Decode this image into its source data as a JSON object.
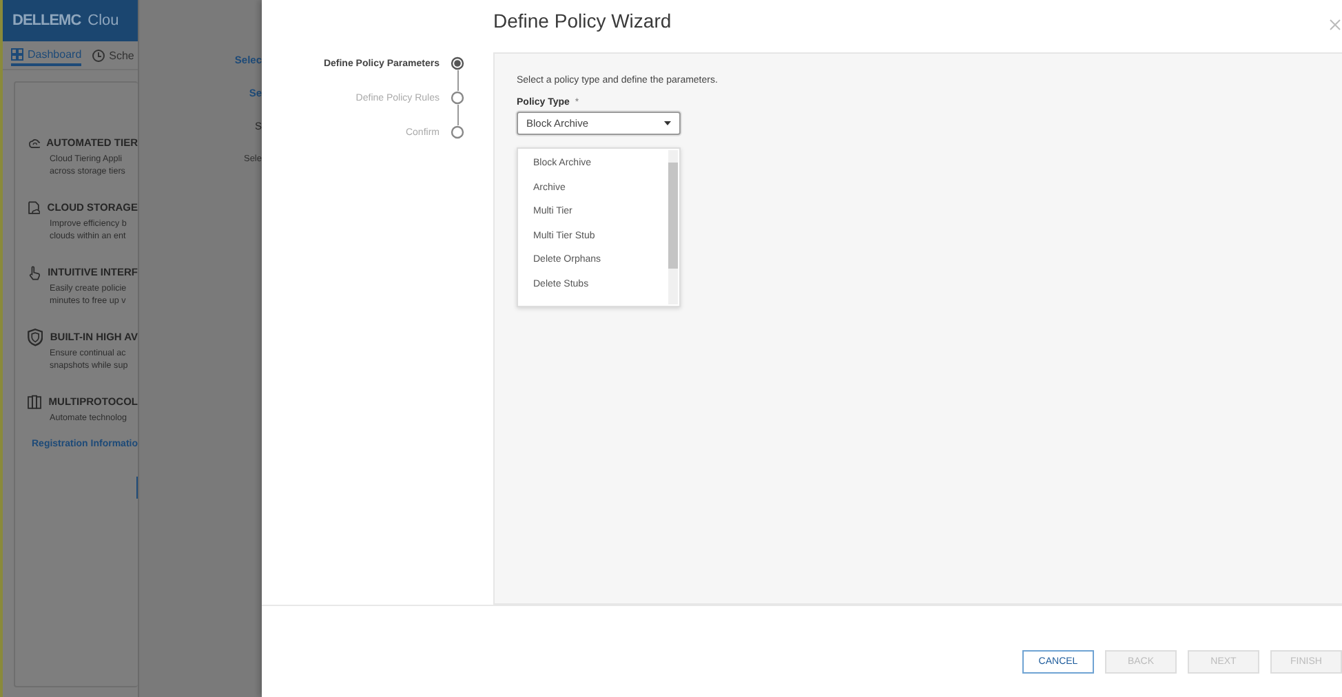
{
  "app": {
    "brand": "DELLEMC",
    "product": "Clou",
    "tabs": [
      {
        "label": "Dashboard",
        "selected": true,
        "kind": "grid"
      },
      {
        "label": "Sche",
        "selected": false,
        "kind": "clock"
      }
    ],
    "features": [
      {
        "kind": "tiering",
        "title": "AUTOMATED TIER",
        "lines": [
          "Cloud Tiering Appli",
          "across storage tiers"
        ]
      },
      {
        "kind": "storage",
        "title": "CLOUD STORAGE",
        "lines": [
          "Improve efficiency b",
          "clouds within an ent"
        ]
      },
      {
        "kind": "interface",
        "title": "INTUITIVE INTERF",
        "lines": [
          "Easily create policie",
          "minutes to free up v"
        ]
      },
      {
        "kind": "availability",
        "title": "BUILT-IN HIGH AV",
        "lines": [
          "Ensure continual ac",
          "snapshots while sup"
        ]
      },
      {
        "kind": "protocol",
        "title": "MULTIPROTOCOL",
        "lines": [
          "Automate technolog"
        ]
      }
    ],
    "link": "Registration Informatio"
  },
  "side_panel": {
    "labels": [
      {
        "text": "Selec",
        "kind": "link"
      },
      {
        "text": "Se",
        "kind": "link"
      },
      {
        "text": "S",
        "kind": "plain"
      },
      {
        "text": "Sele",
        "kind": "hint"
      }
    ]
  },
  "wizard": {
    "title": "Define Policy Wizard",
    "steps": [
      {
        "label": "Define Policy Parameters",
        "selected": true
      },
      {
        "label": "Define Policy Rules",
        "selected": false
      },
      {
        "label": "Confirm",
        "selected": false
      }
    ],
    "instruction": "Select a policy type and define the parameters.",
    "policy_type": {
      "label": "Policy Type",
      "required": "*",
      "value": "Block Archive",
      "expanded": true
    },
    "options": [
      "Block Archive",
      "Archive",
      "Multi Tier",
      "Multi Tier Stub",
      "Delete Orphans",
      "Delete Stubs"
    ],
    "buttons": [
      {
        "label": "CANCEL",
        "disabled": false
      },
      {
        "label": "BACK",
        "disabled": true
      },
      {
        "label": "NEXT",
        "disabled": true
      },
      {
        "label": "FINISH",
        "disabled": true
      }
    ]
  }
}
